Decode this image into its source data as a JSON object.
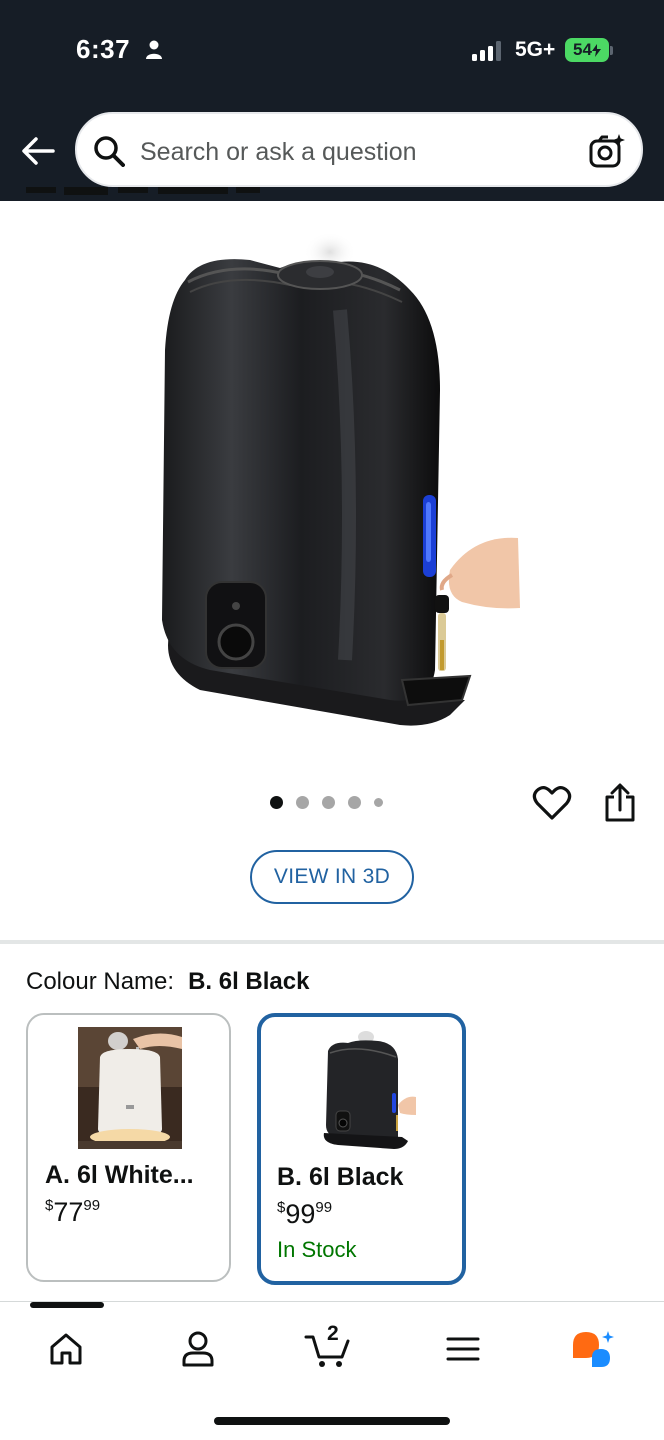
{
  "status_bar": {
    "time": "6:37",
    "network": "5G+",
    "battery": "54"
  },
  "search": {
    "placeholder": "Search or ask a question"
  },
  "product": {
    "image_count": 5,
    "active_image": 1,
    "view_in_3d_label": "VIEW IN 3D"
  },
  "colour": {
    "label": "Colour Name:",
    "selected": "B. 6l Black",
    "options": [
      {
        "name": "A. 6l White...",
        "price_whole": "77",
        "price_fraction": "99",
        "currency": "$",
        "availability": "",
        "selected": false
      },
      {
        "name": "B. 6l Black",
        "price_whole": "99",
        "price_fraction": "99",
        "currency": "$",
        "availability": "In Stock",
        "selected": true
      }
    ]
  },
  "bottom_nav": {
    "items": [
      "home-icon",
      "account-icon",
      "cart-icon",
      "menu-icon",
      "rufus-icon"
    ],
    "cart_count": "2"
  },
  "colors": {
    "header_bg": "#161d26",
    "accent_blue": "#2162a1",
    "in_stock_green": "#007600",
    "battery_green": "#4cd964",
    "rufus_orange": "#ff6a12",
    "rufus_blue": "#1a8cff"
  }
}
